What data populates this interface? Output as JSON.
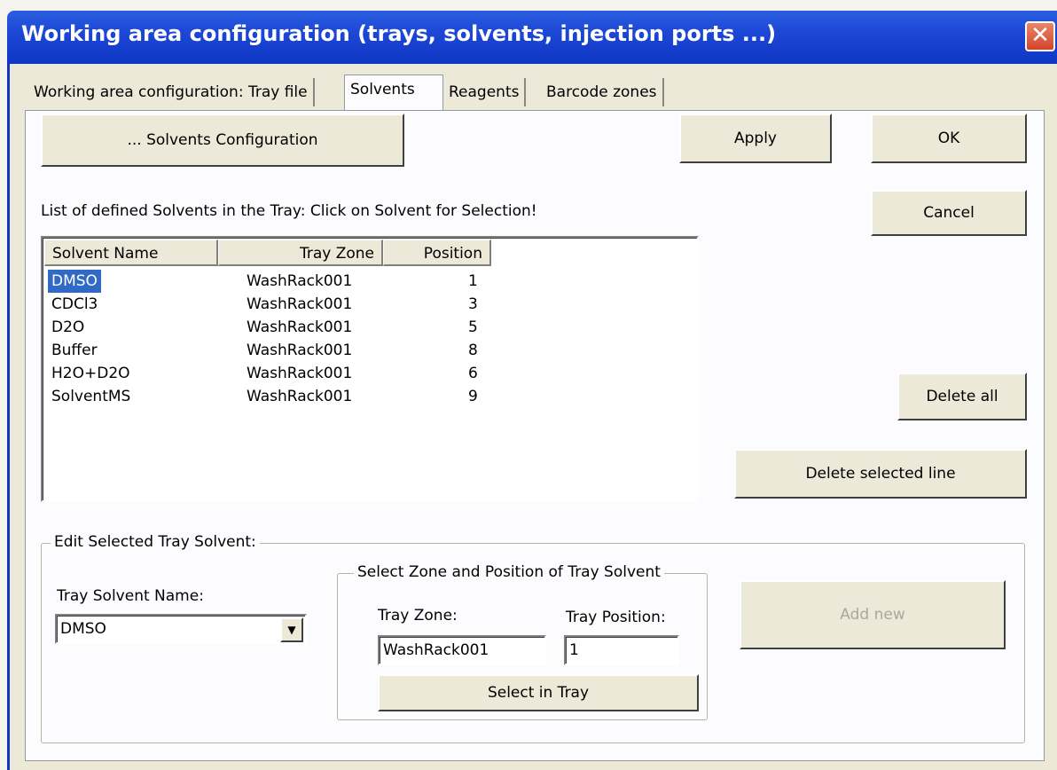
{
  "window": {
    "title": "Working area configuration (trays, solvents, injection ports ...)",
    "close_glyph": "✕"
  },
  "tabs": [
    {
      "label": "Working area configuration: Tray file"
    },
    {
      "label": "Solvents"
    },
    {
      "label": "Reagents"
    },
    {
      "label": "Barcode zones"
    }
  ],
  "active_tab": "Solvents",
  "buttons": {
    "solvents_config": "... Solvents Configuration",
    "apply": "Apply",
    "ok": "OK",
    "cancel": "Cancel",
    "delete_all": "Delete all",
    "delete_selected": "Delete selected line",
    "add_new": "Add new",
    "select_in_tray": "Select in Tray"
  },
  "list": {
    "caption": "List of defined Solvents in the Tray:  Click on Solvent for Selection!",
    "columns": [
      "Solvent Name",
      "Tray Zone",
      "Position"
    ],
    "rows": [
      {
        "name": "DMSO",
        "zone": "WashRack001",
        "position": "1"
      },
      {
        "name": "CDCl3",
        "zone": "WashRack001",
        "position": "3"
      },
      {
        "name": "D2O",
        "zone": "WashRack001",
        "position": "5"
      },
      {
        "name": "Buffer",
        "zone": "WashRack001",
        "position": "8"
      },
      {
        "name": "H2O+D2O",
        "zone": "WashRack001",
        "position": "6"
      },
      {
        "name": "SolventMS",
        "zone": "WashRack001",
        "position": "9"
      }
    ],
    "selected_row": 0
  },
  "edit": {
    "group_title": "Edit Selected Tray Solvent:",
    "name_label": "Tray Solvent Name:",
    "name_value": "DMSO",
    "combo_arrow": "▼",
    "zone_group_title": "Select Zone and Position of Tray Solvent",
    "zone_label": "Tray Zone:",
    "zone_value": "WashRack001",
    "position_label": "Tray Position:",
    "position_value": "1"
  }
}
